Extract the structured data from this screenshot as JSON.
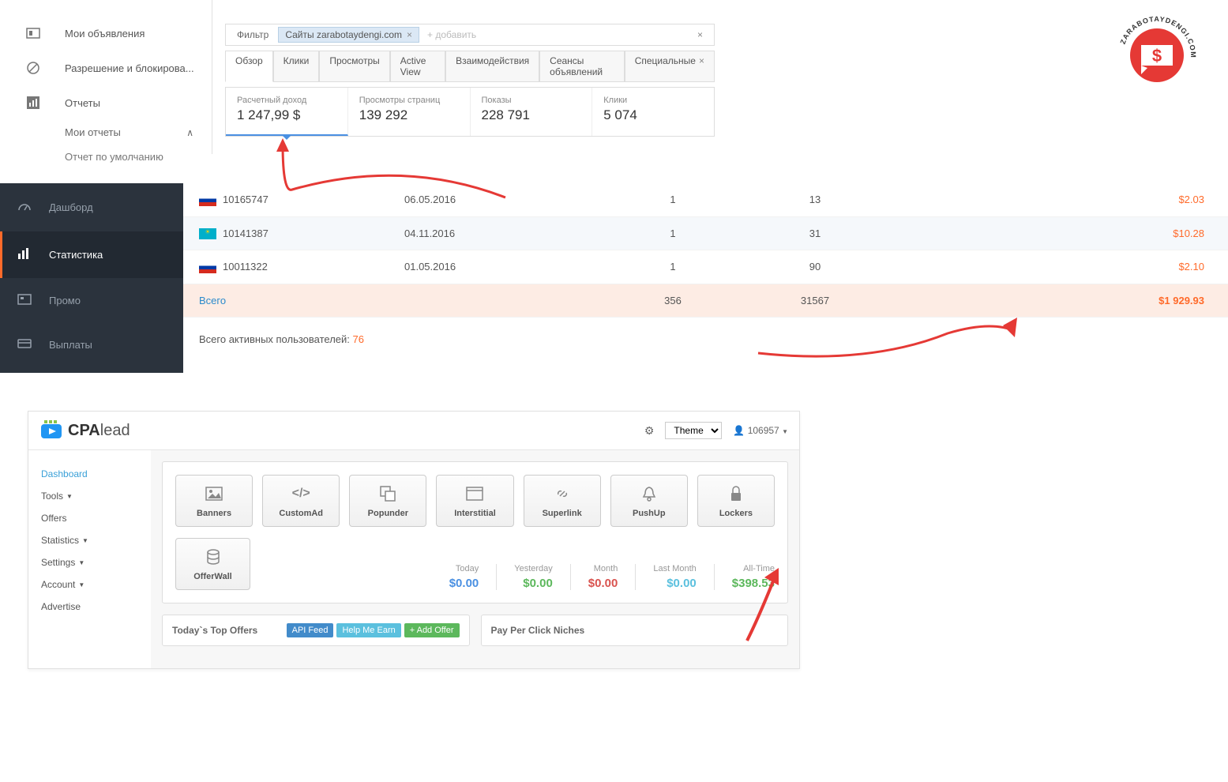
{
  "adsense": {
    "sidebar": {
      "ads": "Мои объявления",
      "blocking": "Разрешение и блокирова...",
      "reports": "Отчеты",
      "myReports": "Мои отчеты",
      "defaultReport": "Отчет по умолчанию"
    },
    "filter": {
      "label": "Фильтр",
      "chip": "Сайты zarabotaydengi.com",
      "add": "+ добавить"
    },
    "tabs": {
      "overview": "Обзор",
      "clicks": "Клики",
      "views": "Просмотры",
      "activeView": "Active View",
      "interactions": "Взаимодействия",
      "sessions": "Сеансы объявлений",
      "special": "Специальные"
    },
    "metrics": {
      "revenue": {
        "label": "Расчетный доход",
        "value": "1 247,99 $"
      },
      "pageviews": {
        "label": "Просмотры страниц",
        "value": "139 292"
      },
      "impressions": {
        "label": "Показы",
        "value": "228 791"
      },
      "clicks": {
        "label": "Клики",
        "value": "5 074"
      }
    }
  },
  "stats": {
    "sidebar": {
      "dashboard": "Дашборд",
      "statistics": "Статистика",
      "promo": "Промо",
      "payouts": "Выплаты"
    },
    "rows": [
      {
        "id": "10165747",
        "date": "06.05.2016",
        "c1": "1",
        "c2": "13",
        "money": "$2.03",
        "flag": "ru"
      },
      {
        "id": "10141387",
        "date": "04.11.2016",
        "c1": "1",
        "c2": "31",
        "money": "$10.28",
        "flag": "kz"
      },
      {
        "id": "10011322",
        "date": "01.05.2016",
        "c1": "1",
        "c2": "90",
        "money": "$2.10",
        "flag": "ru"
      }
    ],
    "total": {
      "label": "Всего",
      "c1": "356",
      "c2": "31567",
      "money": "$1 929.93"
    },
    "activeUsers": {
      "label": "Всего активных пользователей: ",
      "count": "76"
    }
  },
  "cpalead": {
    "brand": {
      "part1": "CPA",
      "part2": "lead"
    },
    "header": {
      "theme": "Theme",
      "user": "106957"
    },
    "sidebar": [
      "Dashboard",
      "Tools",
      "Offers",
      "Statistics",
      "Settings",
      "Account",
      "Advertise"
    ],
    "tools": {
      "banners": "Banners",
      "customad": "CustomAd",
      "popunder": "Popunder",
      "interstitial": "Interstitial",
      "superlink": "Superlink",
      "pushup": "PushUp",
      "lockers": "Lockers",
      "offerwall": "OfferWall"
    },
    "earnings": {
      "today": {
        "label": "Today",
        "value": "$0.00",
        "color": "#4a90e2"
      },
      "yesterday": {
        "label": "Yesterday",
        "value": "$0.00",
        "color": "#5cb85c"
      },
      "month": {
        "label": "Month",
        "value": "$0.00",
        "color": "#d9534f"
      },
      "lastmonth": {
        "label": "Last Month",
        "value": "$0.00",
        "color": "#5bc0de"
      },
      "alltime": {
        "label": "All-Time",
        "value": "$398.53",
        "color": "#5cb85c"
      }
    },
    "panels": {
      "topOffers": "Today`s Top Offers",
      "apiFeed": "API Feed",
      "helpMeEarn": "Help Me Earn",
      "addOffer": "+ Add Offer",
      "ppc": "Pay Per Click Niches"
    }
  },
  "watermark": "ZARABOTAYDENGI.COM"
}
